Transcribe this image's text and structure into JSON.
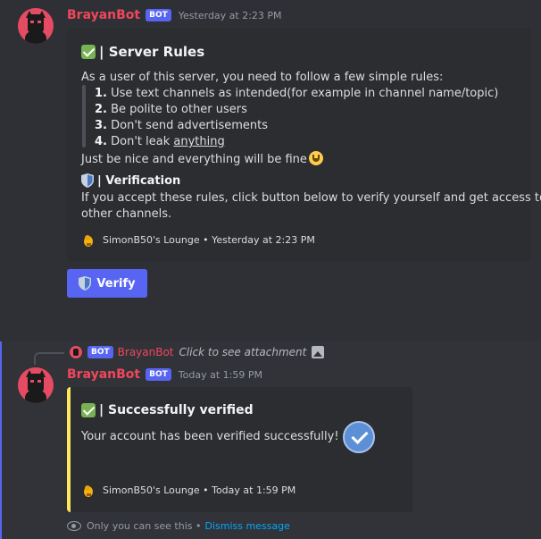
{
  "messages": [
    {
      "username": "BrayanBot",
      "bot_tag": "BOT",
      "timestamp": "Yesterday at 2:23 PM",
      "embed": {
        "title": "| Server Rules",
        "intro": "As a user of this server, you need to follow a few simple rules:",
        "rules": [
          {
            "num": "1.",
            "text": "Use text channels as intended(for example in channel name/topic)"
          },
          {
            "num": "2.",
            "text": "Be polite to other users"
          },
          {
            "num": "3.",
            "text": "Don't send advertisements"
          },
          {
            "num": "4.",
            "text": "Don't leak ",
            "underlined": "anything"
          }
        ],
        "closing": "Just be nice and everything will be fine",
        "section_title": "| Verification",
        "section_text_1": "If you accept these rules, click button below to verify yourself and get access to",
        "section_text_2": "other channels.",
        "footer": "SimonB50's Lounge • Yesterday at 2:23 PM"
      },
      "button_label": "Verify"
    },
    {
      "reply": {
        "bot_tag": "BOT",
        "username": "BrayanBot",
        "text": "Click to see attachment"
      },
      "username": "BrayanBot",
      "bot_tag": "BOT",
      "timestamp": "Today at 1:59 PM",
      "embed": {
        "title": "| Successfully verified",
        "description": "Your account has been verified successfully!",
        "footer": "SimonB50's Lounge • Today at 1:59 PM",
        "accent": "#fee75c"
      },
      "ephemeral_note": "Only you can see this •",
      "dismiss_label": "Dismiss message"
    }
  ],
  "colors": {
    "username": "#f0475b",
    "bot_tag": "#5865f2",
    "button": "#5865f2",
    "link": "#00a8fc"
  }
}
